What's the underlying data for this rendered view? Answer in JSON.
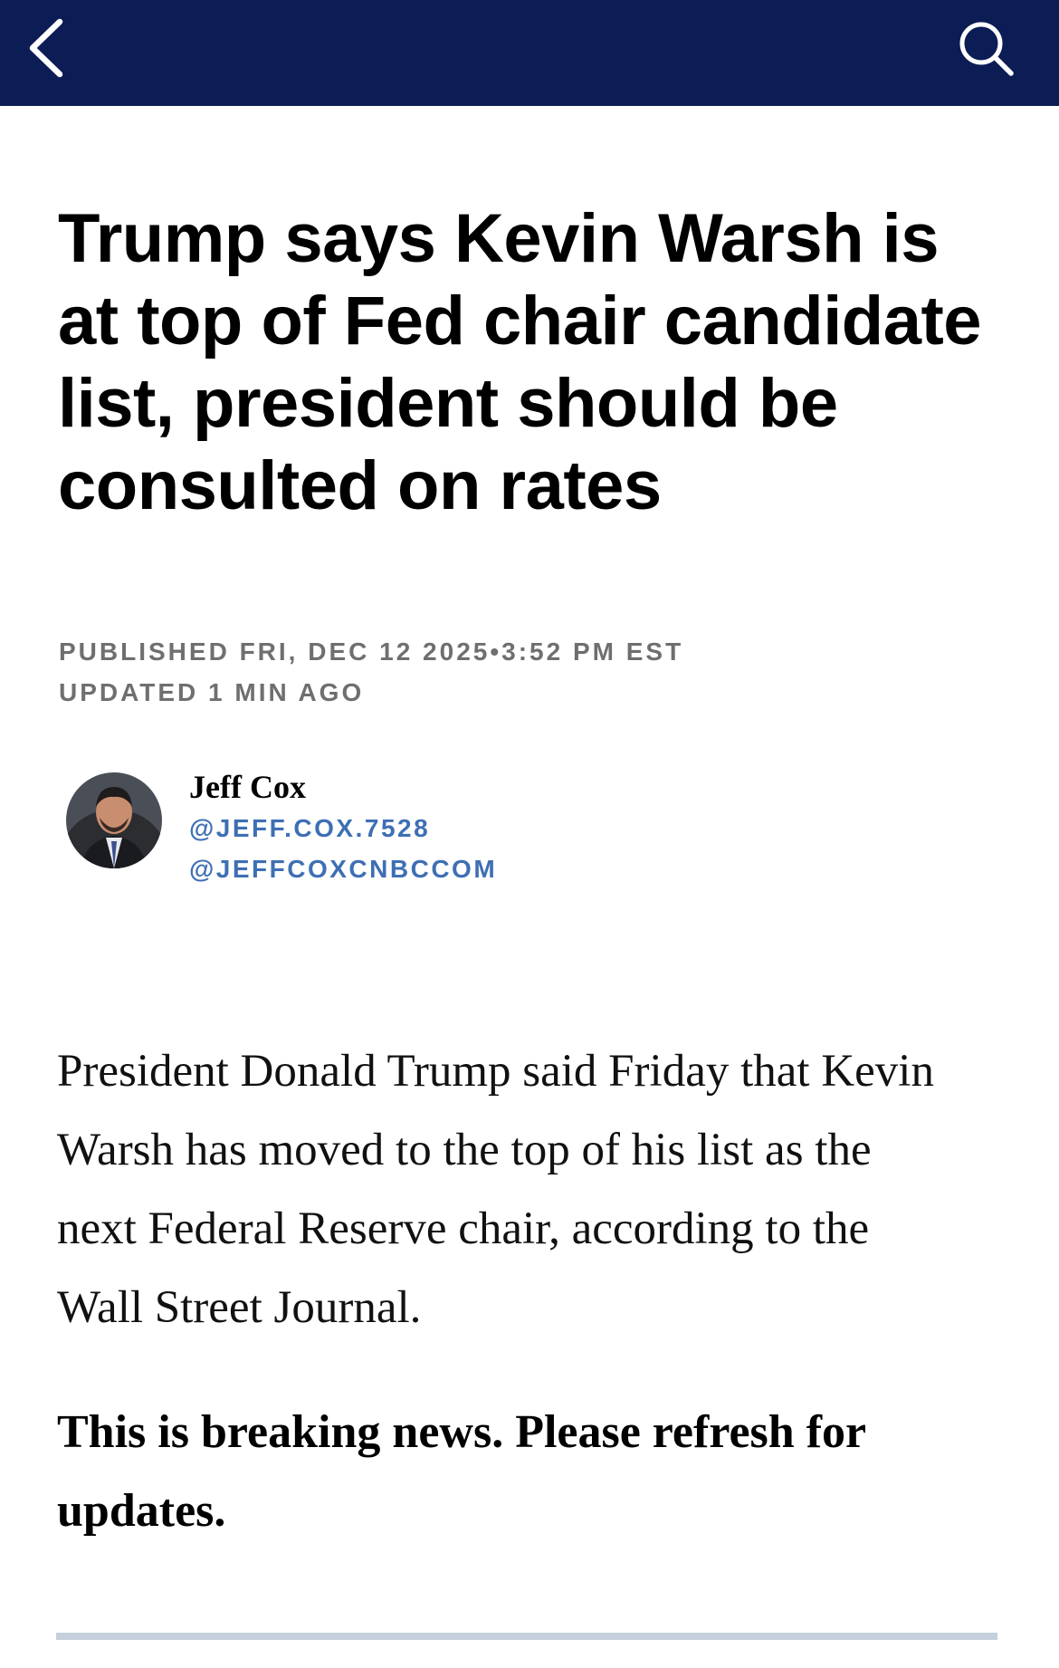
{
  "colors": {
    "nav_background": "#0c1c54",
    "meta_text": "#6f6f6f",
    "handle_link": "#3e6fb4",
    "divider": "#c6d0dc"
  },
  "nav": {
    "back_icon": "chevron-left-icon",
    "search_icon": "search-icon"
  },
  "article": {
    "headline": "Trump says Kevin Warsh is at top of Fed chair candidate list, president should be consulted on rates",
    "published": "PUBLISHED FRI, DEC 12 2025•3:52 PM EST",
    "updated": "UPDATED 1 MIN AGO",
    "body": "President Donald Trump said Friday that Kevin Warsh has moved to the top of his list as the next Federal Reserve chair, according to the Wall Street Journal.",
    "breaking_note": "This is breaking news. Please refresh for updates."
  },
  "author": {
    "name": "Jeff Cox",
    "handle_1": "@JEFF.COX.7528",
    "handle_2": "@JEFFCOXCNBCCOM"
  }
}
